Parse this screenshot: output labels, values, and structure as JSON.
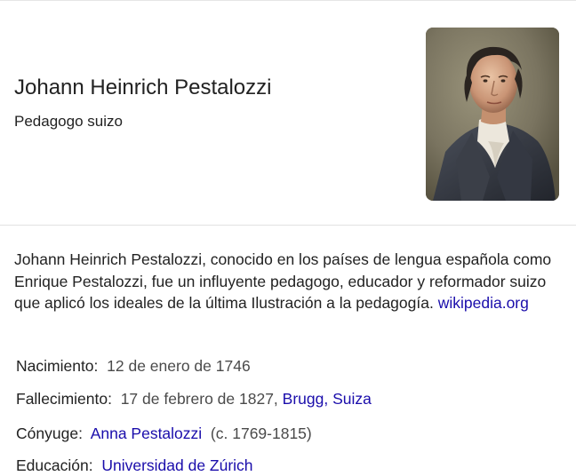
{
  "entity": {
    "name": "Johann Heinrich Pestalozzi",
    "subtitle": "Pedagogo suizo"
  },
  "description": {
    "text": "Johann Heinrich Pestalozzi, conocido en los países de lengua española como Enrique Pestalozzi, fue un influyente pedagogo, educador y reformador suizo que aplicó los ideales de la última Ilustración a la pedagogía.",
    "source_link": "wikipedia.org"
  },
  "facts": {
    "birth": {
      "label": "Nacimiento",
      "value": "12 de enero de 1746"
    },
    "death": {
      "label": "Fallecimiento",
      "value": "17 de febrero de 1827,",
      "place_link": "Brugg, Suiza"
    },
    "spouse": {
      "label": "Cónyuge",
      "name_link": "Anna Pestalozzi",
      "years": "(c. 1769-1815)"
    },
    "education": {
      "label": "Educación",
      "value_link": "Universidad de Zúrich"
    }
  },
  "colors": {
    "link": "#1a0dab",
    "text": "#222222",
    "muted": "#4a4a4a",
    "divider": "#e2e2e2"
  }
}
